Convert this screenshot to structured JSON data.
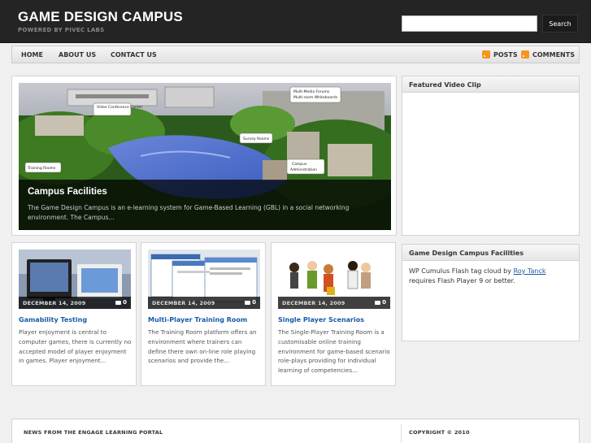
{
  "header": {
    "title": "GAME DESIGN CAMPUS",
    "tagline": "POWERED BY PIVEC LABS",
    "search_button": "Search",
    "search_value": ""
  },
  "nav": {
    "items": [
      {
        "label": "HOME"
      },
      {
        "label": "ABOUT US"
      },
      {
        "label": "CONTACT US"
      }
    ],
    "feeds": [
      {
        "label": "POSTS",
        "icon": "rss-icon"
      },
      {
        "label": "COMMENTS",
        "icon": "rss-icon"
      }
    ]
  },
  "feature": {
    "title": "Campus Facilities",
    "excerpt": "The Game Design Campus is an e-learning system for Game-Based Learning (GBL) in a social networking environment. The Campus...",
    "image_labels": [
      "Video Conference Center",
      "Multi-Media Forums Multi-room Whiteboards",
      "Survey Rooms",
      "Training Rooms",
      "Campus Administration"
    ]
  },
  "sidebar": {
    "video_widget": {
      "title": "Featured Video Clip"
    },
    "facilities_widget": {
      "title": "Game Design Campus Facilities",
      "text_before": "WP Cumulus Flash tag cloud by ",
      "link": "Roy Tanck",
      "text_after": " requires Flash Player 9 or better."
    }
  },
  "posts": [
    {
      "date": "DECEMBER 14, 2009",
      "comments": "0",
      "title": "Gamability Testing",
      "excerpt": "Player enjoyment is central to computer games, there is currently no accepted model of player enjoyment in games. Player enjoyment..."
    },
    {
      "date": "DECEMBER 14, 2009",
      "comments": "0",
      "title": "Multi-Player Training Room",
      "excerpt": "The Training Room platform offers an environment where trainers can define there own on-line role playing scenarios and provide the..."
    },
    {
      "date": "DECEMBER 14, 2009",
      "comments": "0",
      "title": "Single Player Scenarios",
      "excerpt": "The Single-Player Training Room is a customisable online training environment for game-based scenario role-plays providing for individual learning of competencies..."
    }
  ],
  "footer": {
    "left": "NEWS FROM THE ENGAGE LEARNING PORTAL",
    "right": "COPYRIGHT © 2010"
  },
  "colors": {
    "accent_link": "#1a5aa8",
    "header_bg": "#242424",
    "rss": "#f7941e"
  }
}
